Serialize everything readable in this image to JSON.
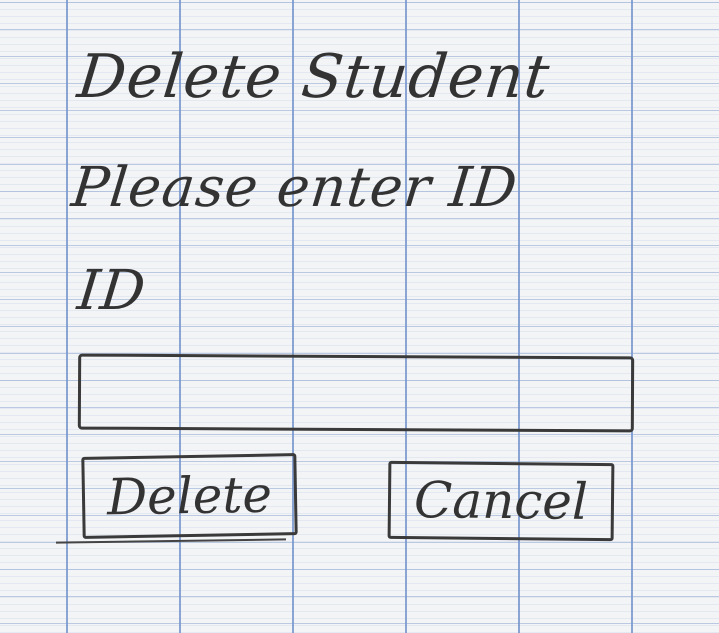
{
  "dialog": {
    "title": "Delete Student",
    "prompt": "Please enter ID",
    "field_label": "ID",
    "input_value": "",
    "delete_label": "Delete",
    "cancel_label": "Cancel"
  }
}
